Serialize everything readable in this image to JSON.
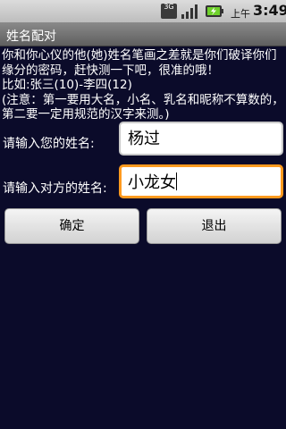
{
  "status_bar": {
    "network_type": "3G",
    "ampm": "上午",
    "time": "3:49",
    "icons": [
      "3g-icon",
      "signal-icon",
      "battery-charging-icon"
    ]
  },
  "app": {
    "title": "姓名配对"
  },
  "description": {
    "line1": "你和你心仪的他(她)姓名笔画之差就是你们破译你们缘分的密码，赶快测一下吧，很准的哦！",
    "line2": "比如:张三(10)-李四(12)",
    "line3": "(注意：第一要用大名，小名、乳名和昵称不算数的，第二要一定用规范的汉字来测。)"
  },
  "form": {
    "your_name_label": "请输入您的姓名:",
    "your_name_value": "杨过",
    "other_name_label": "请输入对方的姓名:",
    "other_name_value": "小龙女"
  },
  "buttons": {
    "confirm": "确定",
    "exit": "退出"
  },
  "colors": {
    "background": "#0b0b2a",
    "focus_border": "#ff9a1f",
    "battery_green": "#6fd12b"
  }
}
